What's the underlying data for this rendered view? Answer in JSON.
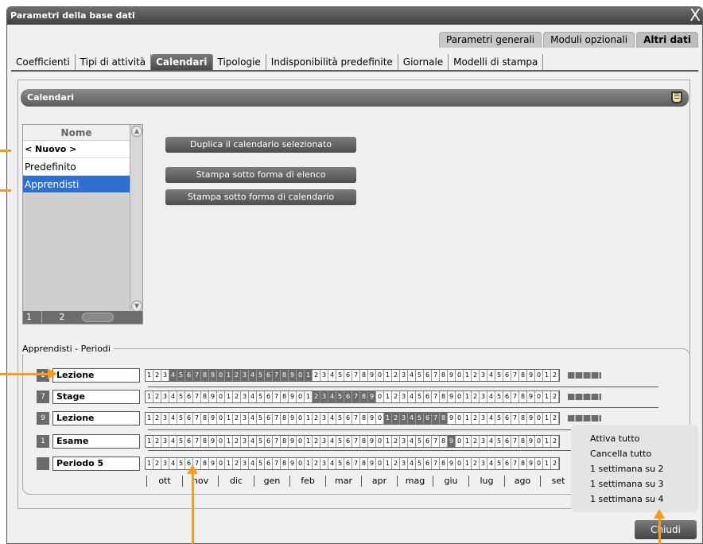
{
  "window": {
    "title": "Parametri della base dati",
    "close_label": "X"
  },
  "top_tabs": [
    {
      "label": "Parametri generali",
      "active": false
    },
    {
      "label": "Moduli opzionali",
      "active": false
    },
    {
      "label": "Altri dati",
      "active": true
    }
  ],
  "sub_tabs": [
    {
      "label": "Coefficienti",
      "active": false
    },
    {
      "label": "Tipi di attività",
      "active": false
    },
    {
      "label": "Calendari",
      "active": true
    },
    {
      "label": "Tipologie",
      "active": false
    },
    {
      "label": "Indisponibilità predefinite",
      "active": false
    },
    {
      "label": "Giornale",
      "active": false
    },
    {
      "label": "Modelli di stampa",
      "active": false
    }
  ],
  "panel": {
    "title": "Calendari"
  },
  "calendar_list": {
    "header": "Nome",
    "items": [
      {
        "label": "< Nuovo >",
        "selected": false
      },
      {
        "label": "Predefinito",
        "selected": false
      },
      {
        "label": "Apprendisti",
        "selected": true
      }
    ],
    "footer": {
      "col1": "1",
      "col2": "2"
    }
  },
  "actions": {
    "duplicate": "Duplica il calendario selezionato",
    "print_list": "Stampa sotto forma di elenco",
    "print_calendar": "Stampa sotto forma di calendario"
  },
  "periods": {
    "group_label": "Apprendisti - Periodi",
    "rows": [
      {
        "badge": "1",
        "name": "Lezione",
        "on_ranges": [
          [
            3,
            20
          ]
        ]
      },
      {
        "badge": "7",
        "name": "Stage",
        "on_ranges": [
          [
            21,
            28
          ]
        ]
      },
      {
        "badge": "9",
        "name": "Lezione",
        "on_ranges": [
          [
            30,
            37
          ]
        ]
      },
      {
        "badge": "1",
        "name": "Esame",
        "on_ranges": [
          [
            38,
            38
          ]
        ]
      },
      {
        "badge": "",
        "name": "Periodo 5",
        "on_ranges": []
      }
    ],
    "cell_labels": [
      "1",
      "2",
      "3",
      "4",
      "5",
      "6",
      "7",
      "8",
      "9",
      "0",
      "1",
      "2",
      "3",
      "4",
      "5",
      "6",
      "7",
      "8",
      "9",
      "0",
      "1",
      "2",
      "3",
      "4",
      "5",
      "6",
      "7",
      "8",
      "9",
      "0",
      "1",
      "2",
      "3",
      "4",
      "5",
      "6",
      "7",
      "8",
      "9",
      "0",
      "1",
      "2",
      "3",
      "4",
      "5",
      "6",
      "7",
      "8",
      "9",
      "0",
      "1",
      "2"
    ],
    "months": [
      "ott",
      "nov",
      "dic",
      "gen",
      "feb",
      "mar",
      "apr",
      "mag",
      "giu",
      "lug",
      "ago",
      "set"
    ]
  },
  "context_menu": {
    "items": [
      "Attiva tutto",
      "Cancella tutto",
      "1 settimana su 2",
      "1 settimana su 3",
      "1 settimana su 4"
    ]
  },
  "footer": {
    "close_button": "Chiudi"
  },
  "colors": {
    "accent_arrow": "#f59a23",
    "selection": "#2f6fd1",
    "dark_gray": "#6b6b6b"
  }
}
